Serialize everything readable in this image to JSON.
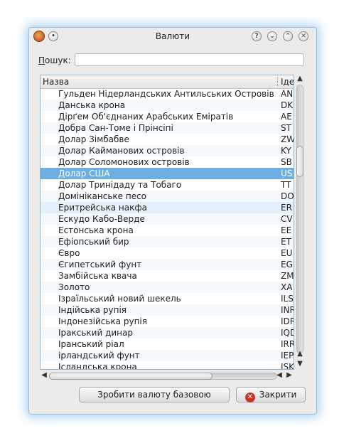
{
  "window": {
    "title": "Валюти",
    "buttons": {
      "menu": "•",
      "help": "?",
      "minimize": "⌄",
      "maximize": "⌃",
      "close": "✕"
    }
  },
  "search": {
    "label_u": "П",
    "label_rest": "ошук:",
    "value": ""
  },
  "table": {
    "headers": {
      "name": "Назва",
      "code": "Іде"
    },
    "rows": [
      {
        "name": "Гульден Нідерландських Антильських Островів",
        "code": "AN"
      },
      {
        "name": "Данська крона",
        "code": "DK"
      },
      {
        "name": "Дірґем Об'єднаних Арабських Еміратів",
        "code": "AE"
      },
      {
        "name": "Добра Сан-Томе і Прінсіпі",
        "code": "ST"
      },
      {
        "name": "Долар Зімбабве",
        "code": "ZW"
      },
      {
        "name": "Долар Кайманових островів",
        "code": "KY"
      },
      {
        "name": "Долар Соломонових островів",
        "code": "SB"
      },
      {
        "name": "Долар США",
        "code": "US"
      },
      {
        "name": "Долар Тринідаду та Тобаго",
        "code": "TT"
      },
      {
        "name": "Домініканське песо",
        "code": "DO"
      },
      {
        "name": "Еритрейська накфа",
        "code": "ER"
      },
      {
        "name": "Ескудо Кабо-Верде",
        "code": "CV"
      },
      {
        "name": "Естонська крона",
        "code": "EE"
      },
      {
        "name": "Ефіопський бир",
        "code": "ET"
      },
      {
        "name": "Євро",
        "code": "EU"
      },
      {
        "name": "Єгипетський фунт",
        "code": "EG"
      },
      {
        "name": "Замбійська квача",
        "code": "ZM"
      },
      {
        "name": "Золото",
        "code": "XA"
      },
      {
        "name": "Ізраїльський новий шекель",
        "code": "ILS"
      },
      {
        "name": "Індійська рупія",
        "code": "INR"
      },
      {
        "name": "Індонезійська рупія",
        "code": "IDR"
      },
      {
        "name": "Іракський динар",
        "code": "IQD"
      },
      {
        "name": "Іранський ріал",
        "code": "IRR"
      },
      {
        "name": "ірландський фунт",
        "code": "IEP"
      },
      {
        "name": "Ісландська крона",
        "code": "ISK"
      }
    ]
  },
  "footer": {
    "set_base_label": "Зробити валюту базовою",
    "close_label": "Закрити"
  },
  "colors": {
    "selection": "#6eaee5",
    "window_glow": "#70b0e6",
    "close_icon": "#c7342c"
  }
}
